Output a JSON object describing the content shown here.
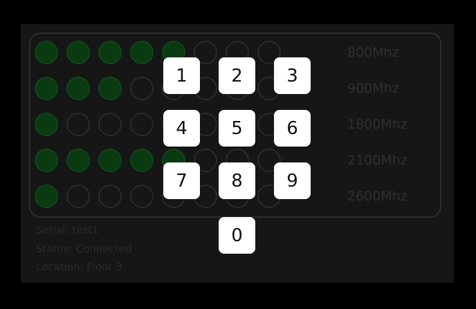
{
  "colors": {
    "background": "#000000",
    "panel_bg": "#161616",
    "active_dot": "#0a3a12",
    "key_bg": "#ffffff",
    "key_text": "#111111"
  },
  "bands": [
    {
      "label": "800Mhz",
      "active": 5
    },
    {
      "label": "900Mhz",
      "active": 3
    },
    {
      "label": "1800Mhz",
      "active": 1
    },
    {
      "label": "2100Mhz",
      "active": 5
    },
    {
      "label": "2600Mhz",
      "active": 1
    }
  ],
  "device": {
    "serial": "Serial: test1",
    "status": "Status: Connected",
    "location": "Location: Floor 3"
  },
  "keypad": {
    "k1": "1",
    "k2": "2",
    "k3": "3",
    "k4": "4",
    "k5": "5",
    "k6": "6",
    "k7": "7",
    "k8": "8",
    "k9": "9",
    "k0": "0"
  }
}
